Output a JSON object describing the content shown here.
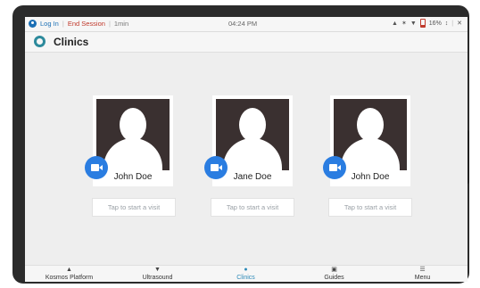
{
  "status_bar": {
    "login_label": "Log In",
    "end_session_label": "End Session",
    "session_duration": "1min",
    "time": "04:24 PM",
    "battery_percent": "16%"
  },
  "header": {
    "title": "Clinics"
  },
  "patients": [
    {
      "name": "John Doe",
      "visit_label": "Tap to start a visit"
    },
    {
      "name": "Jane Doe",
      "visit_label": "Tap to start a visit"
    },
    {
      "name": "John Doe",
      "visit_label": "Tap to start a visit"
    }
  ],
  "nav": {
    "items": [
      {
        "label": "Kosmos Platform",
        "icon": "home-icon"
      },
      {
        "label": "Ultrasound",
        "icon": "probe-icon"
      },
      {
        "label": "Clinics",
        "icon": "clinics-icon",
        "active": true
      },
      {
        "label": "Guides",
        "icon": "guides-icon"
      },
      {
        "label": "Menu",
        "icon": "menu-icon"
      }
    ]
  },
  "colors": {
    "accent": "#2d8ab8",
    "video": "#2a7de1",
    "end_session": "#c0392b",
    "login": "#1b6fb5"
  }
}
